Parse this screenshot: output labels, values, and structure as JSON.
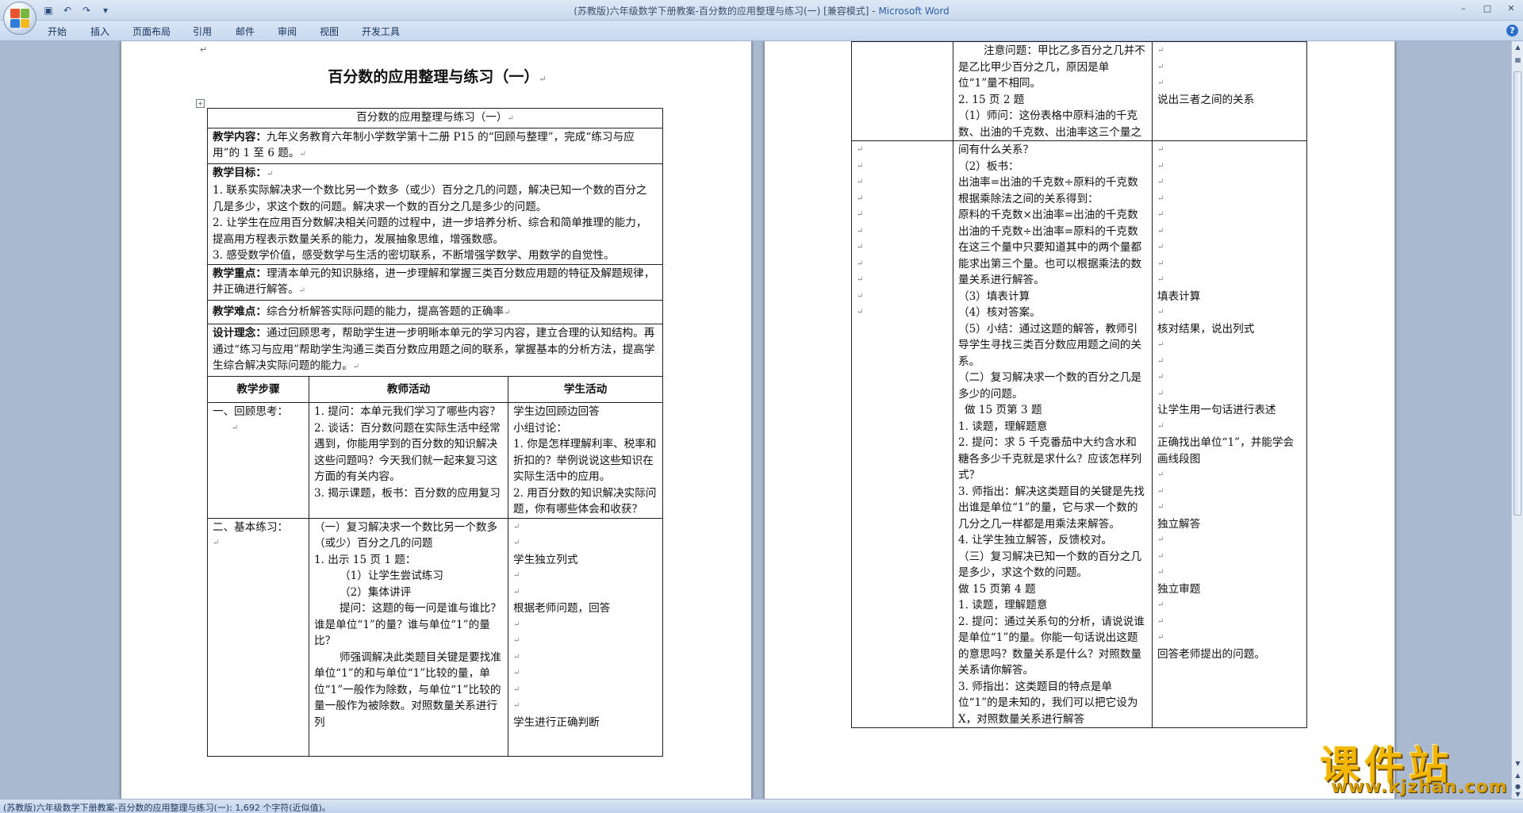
{
  "window": {
    "title": "(苏教版)六年级数学下册教案-百分数的应用整理与练习(一) [兼容模式] - ",
    "app_name": "Microsoft Word"
  },
  "ribbon_tabs": [
    "开始",
    "插入",
    "页面布局",
    "引用",
    "邮件",
    "审阅",
    "视图",
    "开发工具"
  ],
  "status_bar": {
    "text": "(苏教版)六年级数学下册教案-百分数的应用整理与练习(一): 1,692 个字符(近似值)。"
  },
  "page1": {
    "title": "百分数的应用整理与练习（一）",
    "table_title": "百分数的应用整理与练习（一）",
    "content_label": "教学内容：",
    "content_text": "九年义务教育六年制小学数学第十二册 P15 的“回顾与整理”，完成“练习与应用”的 1 至 6 题。",
    "goals_label": "教学目标：",
    "goals": [
      "1. 联系实际解决求一个数比另一个数多（或少）百分之几的问题，解决已知一个数的百分之几是多少，求这个数的问题。解决求一个数的百分之几是多少的问题。",
      "2. 让学生在应用百分数解决相关问题的过程中，进一步培养分析、综合和简单推理的能力，提高用方程表示数量关系的能力，发展抽象思维，增强数感。",
      "3. 感受数学价值，感受数学与生活的密切联系，不断增强学数学、用数学的自觉性。"
    ],
    "key_label": "教学重点：",
    "key_text": "理清本单元的知识脉络，进一步理解和掌握三类百分数应用题的特征及解题规律，并正确进行解答。",
    "difficulty_label": "教学难点：",
    "difficulty_text": "综合分析解答实际问题的能力，提高答题的正确率",
    "design_label": "设计理念：",
    "design_text": "通过回顾思考，帮助学生进一步明晰本单元的学习内容，建立合理的认知结构。再通过“练习与应用”帮助学生沟通三类百分数应用题之间的联系，掌握基本的分析方法，提高学生综合解决实际问题的能力。",
    "col_steps": "教学步骤",
    "col_teacher": "教师活动",
    "col_student": "学生活动",
    "step1": "一、回顾思考：",
    "step1_teacher": [
      "1. 提问：本单元我们学习了哪些内容？",
      "2. 谈话：百分数问题在实际生活中经常遇到，你能用学到的百分数的知识解决这些问题吗？今天我们就一起来复习这方面的有关内容。",
      "3. 揭示课题，板书：百分数的应用复习"
    ],
    "step1_student": [
      "学生边回顾边回答",
      "小组讨论：",
      "1. 你是怎样理解利率、税率和折扣的？举例说说这些知识在实际生活中的应用。",
      "2. 用百分数的知识解决实际问题，你有哪些体会和收获？"
    ],
    "step2": "二、基本练习：",
    "step2_teacher": [
      "（一）复习解决求一个数比另一个数多（或少）百分之几的问题",
      "1. 出示 15 页 1 题：",
      "（1）让学生尝试练习",
      "（2）集体讲评",
      "提问：这题的每一问是谁与谁比？谁是单位“1”的量？谁与单位“1”的量比？",
      "师强调解决此类题目关键是要找准单位“1”的和与单位“1”比较的量，单位“1”一般作为除数，与单位“1”比较的量一般作为被除数。对照数量关系进行列"
    ],
    "step2_student": [
      "学生独立列式",
      "根据老师问题，回答",
      "学生进行正确判断"
    ]
  },
  "page2": {
    "top_teacher": [
      "注意问题：甲比乙多百分之几并不是乙比甲少百分之几，原因是单位“1”量不相同。",
      "2. 15 页 2 题",
      "（1）师问：这份表格中原料油的千克数、出油的千克数、出油率这三个量之"
    ],
    "top_student": "说出三者之间的关系",
    "main_teacher": [
      "间有什么关系？",
      "（2）板书：",
      "出油率=出油的千克数÷原料的千克数",
      "根据乘除法之间的关系得到：",
      "原料的千克数×出油率=出油的千克数",
      "出油的千克数÷出油率=原料的千克数在这三个量中只要知道其中的两个量都能求出第三个量。也可以根据乘法的数量关系进行解答。",
      "（3）填表计算",
      "（4）核对答案。",
      "（5）小结：通过这题的解答，教师引导学生寻找三类百分数应用题之间的关系。",
      "（二）复习解决求一个数的百分之几是多少的问题。",
      "做 15 页第 3 题",
      "1. 读题，理解题意",
      "2. 提问：求 5 千克番茄中大约含水和糖各多少千克就是求什么？应该怎样列式？",
      "3. 师指出：解决这类题目的关键是先找出谁是单位“1”的量，它与求一个数的几分之几一样都是用乘法来解答。",
      "4. 让学生独立解答，反馈校对。",
      "（三）复习解决已知一个数的百分之几是多少，求这个数的问题。",
      "做 15 页第 4 题",
      "1. 读题，理解题意",
      "2. 提问：通过关系句的分析，请说说谁是单位“1”的量。你能一句话说出这题的意思吗？数量关系是什么？对照数量关系请你解答。",
      "3. 师指出：这类题目的特点是单位“1”的是未知的，我们可以把它设为 X，对照数量关系进行解答"
    ],
    "main_student": [
      "填表计算",
      "核对结果，说出列式",
      "让学生用一句话进行表述",
      "正确找出单位“1”，并能学会画线段图",
      "独立解答",
      "独立审题",
      "回答老师提出的问题。"
    ]
  },
  "watermark": {
    "main": "课件站",
    "url": "www.kjzhan.com"
  }
}
